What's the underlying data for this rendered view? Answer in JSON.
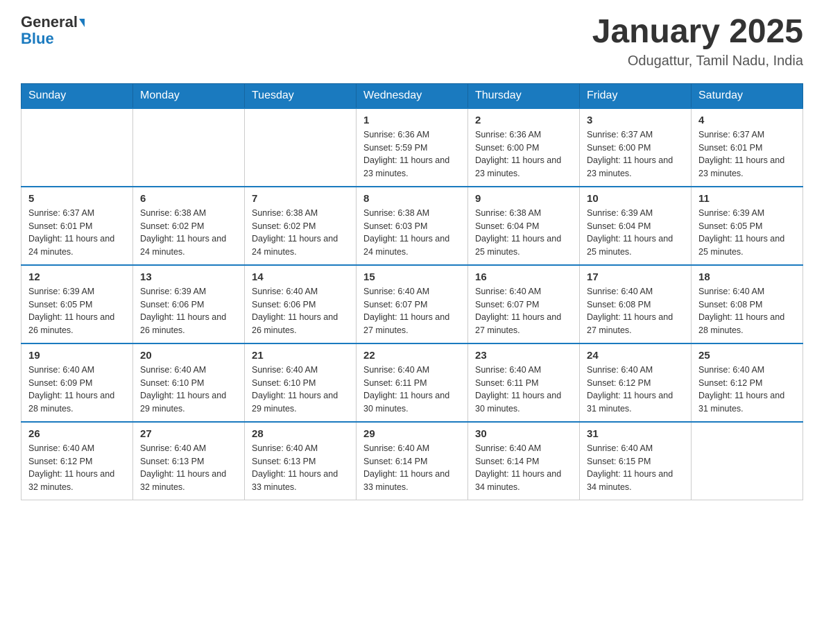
{
  "header": {
    "logo_general": "General",
    "logo_blue": "Blue",
    "month_title": "January 2025",
    "location": "Odugattur, Tamil Nadu, India"
  },
  "days_of_week": [
    "Sunday",
    "Monday",
    "Tuesday",
    "Wednesday",
    "Thursday",
    "Friday",
    "Saturday"
  ],
  "weeks": [
    [
      {
        "num": "",
        "sunrise": "",
        "sunset": "",
        "daylight": ""
      },
      {
        "num": "",
        "sunrise": "",
        "sunset": "",
        "daylight": ""
      },
      {
        "num": "",
        "sunrise": "",
        "sunset": "",
        "daylight": ""
      },
      {
        "num": "1",
        "sunrise": "Sunrise: 6:36 AM",
        "sunset": "Sunset: 5:59 PM",
        "daylight": "Daylight: 11 hours and 23 minutes."
      },
      {
        "num": "2",
        "sunrise": "Sunrise: 6:36 AM",
        "sunset": "Sunset: 6:00 PM",
        "daylight": "Daylight: 11 hours and 23 minutes."
      },
      {
        "num": "3",
        "sunrise": "Sunrise: 6:37 AM",
        "sunset": "Sunset: 6:00 PM",
        "daylight": "Daylight: 11 hours and 23 minutes."
      },
      {
        "num": "4",
        "sunrise": "Sunrise: 6:37 AM",
        "sunset": "Sunset: 6:01 PM",
        "daylight": "Daylight: 11 hours and 23 minutes."
      }
    ],
    [
      {
        "num": "5",
        "sunrise": "Sunrise: 6:37 AM",
        "sunset": "Sunset: 6:01 PM",
        "daylight": "Daylight: 11 hours and 24 minutes."
      },
      {
        "num": "6",
        "sunrise": "Sunrise: 6:38 AM",
        "sunset": "Sunset: 6:02 PM",
        "daylight": "Daylight: 11 hours and 24 minutes."
      },
      {
        "num": "7",
        "sunrise": "Sunrise: 6:38 AM",
        "sunset": "Sunset: 6:02 PM",
        "daylight": "Daylight: 11 hours and 24 minutes."
      },
      {
        "num": "8",
        "sunrise": "Sunrise: 6:38 AM",
        "sunset": "Sunset: 6:03 PM",
        "daylight": "Daylight: 11 hours and 24 minutes."
      },
      {
        "num": "9",
        "sunrise": "Sunrise: 6:38 AM",
        "sunset": "Sunset: 6:04 PM",
        "daylight": "Daylight: 11 hours and 25 minutes."
      },
      {
        "num": "10",
        "sunrise": "Sunrise: 6:39 AM",
        "sunset": "Sunset: 6:04 PM",
        "daylight": "Daylight: 11 hours and 25 minutes."
      },
      {
        "num": "11",
        "sunrise": "Sunrise: 6:39 AM",
        "sunset": "Sunset: 6:05 PM",
        "daylight": "Daylight: 11 hours and 25 minutes."
      }
    ],
    [
      {
        "num": "12",
        "sunrise": "Sunrise: 6:39 AM",
        "sunset": "Sunset: 6:05 PM",
        "daylight": "Daylight: 11 hours and 26 minutes."
      },
      {
        "num": "13",
        "sunrise": "Sunrise: 6:39 AM",
        "sunset": "Sunset: 6:06 PM",
        "daylight": "Daylight: 11 hours and 26 minutes."
      },
      {
        "num": "14",
        "sunrise": "Sunrise: 6:40 AM",
        "sunset": "Sunset: 6:06 PM",
        "daylight": "Daylight: 11 hours and 26 minutes."
      },
      {
        "num": "15",
        "sunrise": "Sunrise: 6:40 AM",
        "sunset": "Sunset: 6:07 PM",
        "daylight": "Daylight: 11 hours and 27 minutes."
      },
      {
        "num": "16",
        "sunrise": "Sunrise: 6:40 AM",
        "sunset": "Sunset: 6:07 PM",
        "daylight": "Daylight: 11 hours and 27 minutes."
      },
      {
        "num": "17",
        "sunrise": "Sunrise: 6:40 AM",
        "sunset": "Sunset: 6:08 PM",
        "daylight": "Daylight: 11 hours and 27 minutes."
      },
      {
        "num": "18",
        "sunrise": "Sunrise: 6:40 AM",
        "sunset": "Sunset: 6:08 PM",
        "daylight": "Daylight: 11 hours and 28 minutes."
      }
    ],
    [
      {
        "num": "19",
        "sunrise": "Sunrise: 6:40 AM",
        "sunset": "Sunset: 6:09 PM",
        "daylight": "Daylight: 11 hours and 28 minutes."
      },
      {
        "num": "20",
        "sunrise": "Sunrise: 6:40 AM",
        "sunset": "Sunset: 6:10 PM",
        "daylight": "Daylight: 11 hours and 29 minutes."
      },
      {
        "num": "21",
        "sunrise": "Sunrise: 6:40 AM",
        "sunset": "Sunset: 6:10 PM",
        "daylight": "Daylight: 11 hours and 29 minutes."
      },
      {
        "num": "22",
        "sunrise": "Sunrise: 6:40 AM",
        "sunset": "Sunset: 6:11 PM",
        "daylight": "Daylight: 11 hours and 30 minutes."
      },
      {
        "num": "23",
        "sunrise": "Sunrise: 6:40 AM",
        "sunset": "Sunset: 6:11 PM",
        "daylight": "Daylight: 11 hours and 30 minutes."
      },
      {
        "num": "24",
        "sunrise": "Sunrise: 6:40 AM",
        "sunset": "Sunset: 6:12 PM",
        "daylight": "Daylight: 11 hours and 31 minutes."
      },
      {
        "num": "25",
        "sunrise": "Sunrise: 6:40 AM",
        "sunset": "Sunset: 6:12 PM",
        "daylight": "Daylight: 11 hours and 31 minutes."
      }
    ],
    [
      {
        "num": "26",
        "sunrise": "Sunrise: 6:40 AM",
        "sunset": "Sunset: 6:12 PM",
        "daylight": "Daylight: 11 hours and 32 minutes."
      },
      {
        "num": "27",
        "sunrise": "Sunrise: 6:40 AM",
        "sunset": "Sunset: 6:13 PM",
        "daylight": "Daylight: 11 hours and 32 minutes."
      },
      {
        "num": "28",
        "sunrise": "Sunrise: 6:40 AM",
        "sunset": "Sunset: 6:13 PM",
        "daylight": "Daylight: 11 hours and 33 minutes."
      },
      {
        "num": "29",
        "sunrise": "Sunrise: 6:40 AM",
        "sunset": "Sunset: 6:14 PM",
        "daylight": "Daylight: 11 hours and 33 minutes."
      },
      {
        "num": "30",
        "sunrise": "Sunrise: 6:40 AM",
        "sunset": "Sunset: 6:14 PM",
        "daylight": "Daylight: 11 hours and 34 minutes."
      },
      {
        "num": "31",
        "sunrise": "Sunrise: 6:40 AM",
        "sunset": "Sunset: 6:15 PM",
        "daylight": "Daylight: 11 hours and 34 minutes."
      },
      {
        "num": "",
        "sunrise": "",
        "sunset": "",
        "daylight": ""
      }
    ]
  ]
}
